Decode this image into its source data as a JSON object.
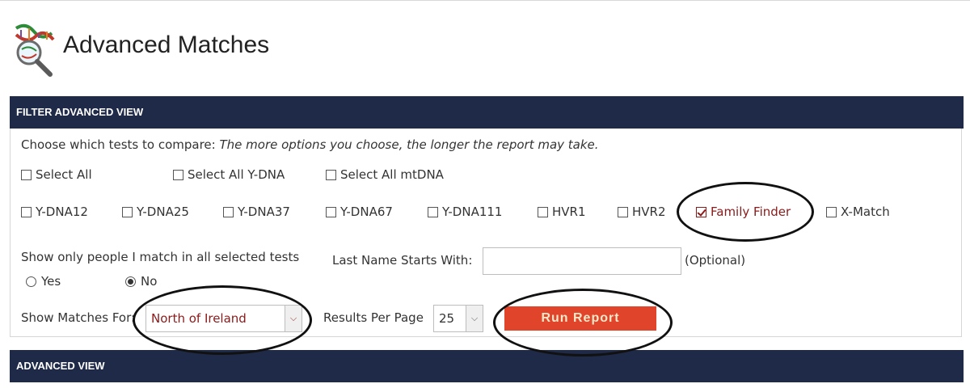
{
  "header": {
    "title": "Advanced Matches",
    "logo_icon": "dna-magnifier-icon"
  },
  "filter_bar": {
    "title": "FILTER ADVANCED VIEW"
  },
  "filter": {
    "instruction": "Choose which tests to compare:",
    "hint": "The more options you choose, the longer the report may take.",
    "select_all": [
      {
        "label": "Select All",
        "checked": false
      },
      {
        "label": "Select All Y-DNA",
        "checked": false
      },
      {
        "label": "Select All mtDNA",
        "checked": false
      }
    ],
    "tests": [
      {
        "label": "Y-DNA12",
        "checked": false
      },
      {
        "label": "Y-DNA25",
        "checked": false
      },
      {
        "label": "Y-DNA37",
        "checked": false
      },
      {
        "label": "Y-DNA67",
        "checked": false
      },
      {
        "label": "Y-DNA111",
        "checked": false
      },
      {
        "label": "HVR1",
        "checked": false
      },
      {
        "label": "HVR2",
        "checked": false
      },
      {
        "label": "Family Finder",
        "checked": true
      },
      {
        "label": "X-Match",
        "checked": false
      }
    ],
    "match_all_label": "Show only people I match in all selected tests",
    "match_all_options": [
      {
        "label": "Yes",
        "selected": false
      },
      {
        "label": "No",
        "selected": true
      }
    ],
    "last_name_label": "Last Name Starts With:",
    "last_name_value": "",
    "optional_label": "(Optional)",
    "show_matches_label": "Show Matches For:",
    "show_matches_value": "North of Ireland",
    "results_per_page_label": "Results Per Page",
    "results_per_page_value": "25",
    "run_report_label": "Run Report"
  },
  "advanced_bar": {
    "title": "ADVANCED VIEW"
  },
  "colors": {
    "nav_bar": "#1e2a47",
    "run_button": "#e0452b",
    "selected_text": "#8b1a1a",
    "annotation": "#111111"
  }
}
